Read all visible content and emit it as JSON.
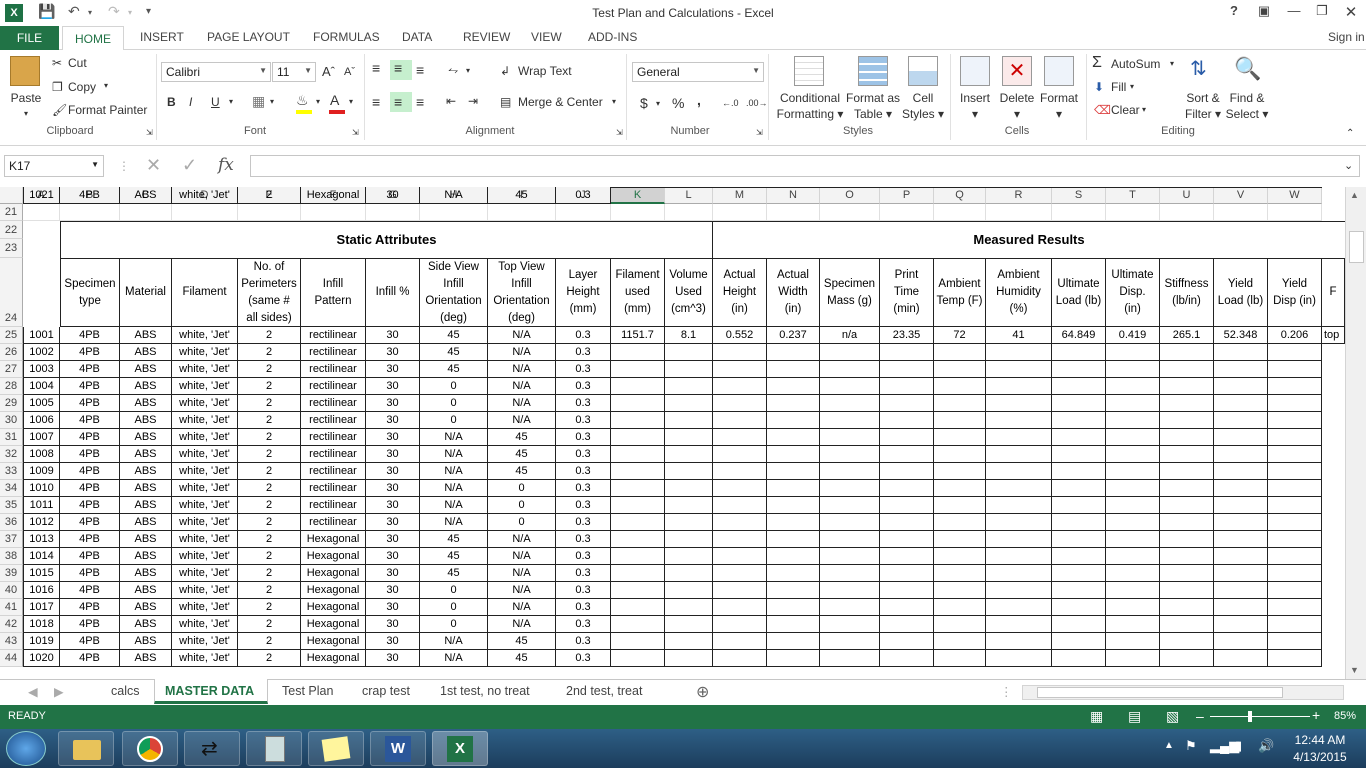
{
  "window": {
    "title": "Test Plan and Calculations - Excel",
    "help": "?",
    "signin": "Sign in"
  },
  "tabs": [
    "FILE",
    "HOME",
    "INSERT",
    "PAGE LAYOUT",
    "FORMULAS",
    "DATA",
    "REVIEW",
    "VIEW",
    "ADD-INS"
  ],
  "ribbon": {
    "clipboard": {
      "paste": "Paste",
      "cut": "Cut",
      "copy": "Copy",
      "format_painter": "Format Painter",
      "label": "Clipboard"
    },
    "font": {
      "name": "Calibri",
      "size": "11",
      "label": "Font",
      "bold": "B",
      "italic": "I",
      "underline": "U"
    },
    "alignment": {
      "wrap": "Wrap Text",
      "merge": "Merge & Center",
      "label": "Alignment"
    },
    "number": {
      "format": "General",
      "currency": "$",
      "percent": "%",
      "comma": ",",
      "label": "Number"
    },
    "styles": {
      "conditional": [
        "Conditional",
        "Formatting"
      ],
      "format_table": [
        "Format as",
        "Table"
      ],
      "cell_styles": [
        "Cell",
        "Styles"
      ],
      "label": "Styles"
    },
    "cells": {
      "insert": "Insert",
      "delete": "Delete",
      "format": "Format",
      "label": "Cells"
    },
    "editing": {
      "autosum": "AutoSum",
      "fill": "Fill",
      "clear": "Clear",
      "sort": [
        "Sort &",
        "Filter"
      ],
      "find": [
        "Find &",
        "Select"
      ],
      "label": "Editing"
    }
  },
  "formula_bar": {
    "name_box": "K17",
    "fx": "fx",
    "value": ""
  },
  "columns": [
    "A",
    "B",
    "C",
    "D",
    "E",
    "F",
    "G",
    "H",
    "I",
    "J",
    "K",
    "L",
    "M",
    "N",
    "O",
    "P",
    "Q",
    "R",
    "S",
    "T",
    "U",
    "V",
    "W"
  ],
  "row_numbers": [
    "21",
    "22",
    "23",
    "24",
    "25",
    "26",
    "27",
    "28",
    "29",
    "30",
    "31",
    "32",
    "33",
    "34",
    "35",
    "36",
    "37",
    "38",
    "39",
    "40",
    "41",
    "42",
    "43",
    "44"
  ],
  "bands": {
    "static": "Static Attributes",
    "measured": "Measured Results"
  },
  "headers": [
    [
      "Specimen",
      "type"
    ],
    [
      "Material"
    ],
    [
      "Filament"
    ],
    [
      "No. of",
      "Perimeters",
      "(same #",
      "all sides)"
    ],
    [
      "Infill",
      "Pattern"
    ],
    [
      "Infill %"
    ],
    [
      "Side View",
      "Infill",
      "Orientation",
      "(deg)"
    ],
    [
      "Top View",
      "Infill",
      "Orientation",
      "(deg)"
    ],
    [
      "Layer",
      "Height",
      "(mm)"
    ],
    [
      "Filament",
      "used",
      "(mm)"
    ],
    [
      "Volume",
      "Used",
      "(cm^3)"
    ],
    [
      "Actual",
      "Height",
      "(in)"
    ],
    [
      "Actual",
      "Width",
      "(in)"
    ],
    [
      "Specimen",
      "Mass (g)"
    ],
    [
      "Print",
      "Time",
      "(min)"
    ],
    [
      "Ambient",
      "Temp (F)"
    ],
    [
      "Ambient",
      "Humidity",
      "(%)"
    ],
    [
      "Ultimate",
      "Load (lb)"
    ],
    [
      "Ultimate",
      "Disp.",
      "(in)"
    ],
    [
      "Stiffness",
      "(lb/in)"
    ],
    [
      "Yield",
      "Load (lb)"
    ],
    [
      "Yield",
      "Disp (in)"
    ],
    [
      "F"
    ]
  ],
  "rows": [
    [
      "1001",
      "4PB",
      "ABS",
      "white, 'Jet'",
      "2",
      "rectilinear",
      "30",
      "45",
      "N/A",
      "0.3",
      "1151.7",
      "8.1",
      "0.552",
      "0.237",
      "n/a",
      "23.35",
      "72",
      "41",
      "64.849",
      "0.419",
      "265.1",
      "52.348",
      "0.206",
      "top"
    ],
    [
      "1002",
      "4PB",
      "ABS",
      "white, 'Jet'",
      "2",
      "rectilinear",
      "30",
      "45",
      "N/A",
      "0.3"
    ],
    [
      "1003",
      "4PB",
      "ABS",
      "white, 'Jet'",
      "2",
      "rectilinear",
      "30",
      "45",
      "N/A",
      "0.3"
    ],
    [
      "1004",
      "4PB",
      "ABS",
      "white, 'Jet'",
      "2",
      "rectilinear",
      "30",
      "0",
      "N/A",
      "0.3"
    ],
    [
      "1005",
      "4PB",
      "ABS",
      "white, 'Jet'",
      "2",
      "rectilinear",
      "30",
      "0",
      "N/A",
      "0.3"
    ],
    [
      "1006",
      "4PB",
      "ABS",
      "white, 'Jet'",
      "2",
      "rectilinear",
      "30",
      "0",
      "N/A",
      "0.3"
    ],
    [
      "1007",
      "4PB",
      "ABS",
      "white, 'Jet'",
      "2",
      "rectilinear",
      "30",
      "N/A",
      "45",
      "0.3"
    ],
    [
      "1008",
      "4PB",
      "ABS",
      "white, 'Jet'",
      "2",
      "rectilinear",
      "30",
      "N/A",
      "45",
      "0.3"
    ],
    [
      "1009",
      "4PB",
      "ABS",
      "white, 'Jet'",
      "2",
      "rectilinear",
      "30",
      "N/A",
      "45",
      "0.3"
    ],
    [
      "1010",
      "4PB",
      "ABS",
      "white, 'Jet'",
      "2",
      "rectilinear",
      "30",
      "N/A",
      "0",
      "0.3"
    ],
    [
      "1011",
      "4PB",
      "ABS",
      "white, 'Jet'",
      "2",
      "rectilinear",
      "30",
      "N/A",
      "0",
      "0.3"
    ],
    [
      "1012",
      "4PB",
      "ABS",
      "white, 'Jet'",
      "2",
      "rectilinear",
      "30",
      "N/A",
      "0",
      "0.3"
    ],
    [
      "1013",
      "4PB",
      "ABS",
      "white, 'Jet'",
      "2",
      "Hexagonal",
      "30",
      "45",
      "N/A",
      "0.3"
    ],
    [
      "1014",
      "4PB",
      "ABS",
      "white, 'Jet'",
      "2",
      "Hexagonal",
      "30",
      "45",
      "N/A",
      "0.3"
    ],
    [
      "1015",
      "4PB",
      "ABS",
      "white, 'Jet'",
      "2",
      "Hexagonal",
      "30",
      "45",
      "N/A",
      "0.3"
    ],
    [
      "1016",
      "4PB",
      "ABS",
      "white, 'Jet'",
      "2",
      "Hexagonal",
      "30",
      "0",
      "N/A",
      "0.3"
    ],
    [
      "1017",
      "4PB",
      "ABS",
      "white, 'Jet'",
      "2",
      "Hexagonal",
      "30",
      "0",
      "N/A",
      "0.3"
    ],
    [
      "1018",
      "4PB",
      "ABS",
      "white, 'Jet'",
      "2",
      "Hexagonal",
      "30",
      "0",
      "N/A",
      "0.3"
    ],
    [
      "1019",
      "4PB",
      "ABS",
      "white, 'Jet'",
      "2",
      "Hexagonal",
      "30",
      "N/A",
      "45",
      "0.3"
    ],
    [
      "1020",
      "4PB",
      "ABS",
      "white, 'Jet'",
      "2",
      "Hexagonal",
      "30",
      "N/A",
      "45",
      "0.3"
    ],
    [
      "1021",
      "4PB",
      "ABS",
      "white, 'Jet'",
      "2",
      "Hexagonal",
      "30",
      "N/A",
      "45",
      "0.3"
    ]
  ],
  "sheets": [
    "calcs",
    "MASTER DATA",
    "Test Plan",
    "crap test",
    "1st test, no treat",
    "2nd test, treat"
  ],
  "active_sheet": "MASTER DATA",
  "status": {
    "ready": "READY",
    "zoom": "85%"
  },
  "clock": {
    "time": "12:44 AM",
    "date": "4/13/2015"
  },
  "colors": {
    "excel_green": "#217346",
    "selected_green": "#c6efce"
  }
}
